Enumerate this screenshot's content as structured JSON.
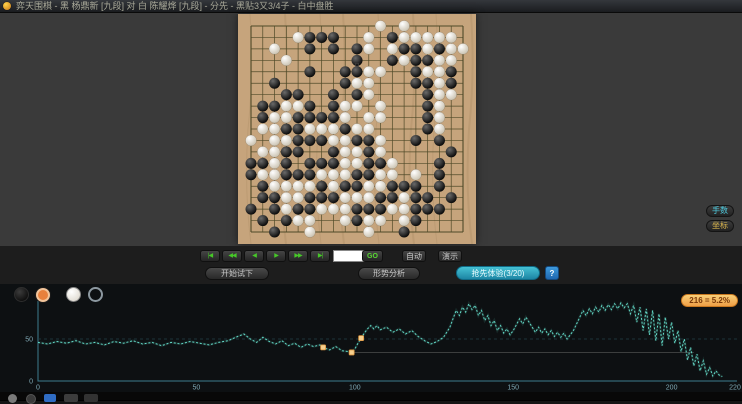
{
  "window": {
    "title": "弈天围棋 - 黑 杨鼎新 [九段] 对 白 陈耀烨 [九段] - 分先 - 黑贴3又3/4子 - 白中盘胜"
  },
  "board": {
    "size": 19,
    "wood_color": "#c6a47c",
    "line_color": "#4f4a28",
    "rows": [
      "...........W.W.....",
      "....WBBB..W.BWWWWW.",
      "..W..B.B.BW.WBBWBWW",
      "...W.....B..BWBBWW.",
      ".....B..BBWW..BWWB.",
      "..B.....BWW...BBWB.",
      "...BB..B.BW....BWW.",
      ".BBWWB.BWW.W...BW..",
      ".BWWBBBBW.WW...BW..",
      ".WWBBWWWBWW....BW..",
      "W.WWBBBWWBBW..B.B..",
      ".WWBB..BWWBW.....B.",
      "BBWB.BBBWWBBW...B..",
      "BWWBBBWWWBBWW.W.B..",
      ".BWWWWBWBBWWBBB.B..",
      ".BBWWBBBWWWBBWBB.B.",
      "B.BWBBWWWBBBWWBBB..",
      ".B.BWW..WBWW.WB....",
      "..B..W....W..B....."
    ],
    "last_move": {
      "col": 10,
      "row": 4
    }
  },
  "side_buttons": [
    {
      "label": "手数",
      "color": "#4cc8dc"
    },
    {
      "label": "坐标",
      "color": "#d8b44c"
    }
  ],
  "controls": {
    "nav": [
      "|◀",
      "◀◀",
      "◀",
      "▶",
      "▶▶",
      "▶|"
    ],
    "move_input_value": "",
    "go_label": "GO",
    "auto_label": "自动",
    "demo_label": "演示",
    "trial_label": "开始试下",
    "analysis_label": "形势分析",
    "premium_label": "抢先体验(3/20)",
    "help_label": "?"
  },
  "chart_data": {
    "type": "line",
    "title": "",
    "xlabel": "",
    "ylabel": "",
    "xlim": [
      0,
      220
    ],
    "ylim": [
      0,
      100
    ],
    "x_ticks": [
      0,
      50,
      100,
      150,
      200,
      220
    ],
    "y_ticks": [
      0,
      50
    ],
    "grid_50_percent": true,
    "axis_color": "#3d7c8e",
    "tick_label_color": "#7fa8b4",
    "legend": [
      "black-winrate-selected",
      "white-winrate"
    ],
    "series": [
      {
        "name": "win-rate",
        "color": "#62d8c6",
        "points": [
          [
            0,
            46
          ],
          [
            3,
            44
          ],
          [
            6,
            47
          ],
          [
            9,
            45
          ],
          [
            12,
            48
          ],
          [
            15,
            44
          ],
          [
            18,
            46
          ],
          [
            21,
            43
          ],
          [
            24,
            47
          ],
          [
            27,
            45
          ],
          [
            30,
            48
          ],
          [
            33,
            44
          ],
          [
            36,
            46
          ],
          [
            39,
            42
          ],
          [
            42,
            46
          ],
          [
            45,
            44
          ],
          [
            48,
            47
          ],
          [
            51,
            45
          ],
          [
            54,
            43
          ],
          [
            57,
            46
          ],
          [
            60,
            48
          ],
          [
            63,
            53
          ],
          [
            65,
            56
          ],
          [
            67,
            50
          ],
          [
            69,
            46
          ],
          [
            71,
            52
          ],
          [
            73,
            47
          ],
          [
            75,
            44
          ],
          [
            77,
            48
          ],
          [
            79,
            42
          ],
          [
            81,
            45
          ],
          [
            83,
            40
          ],
          [
            85,
            44
          ],
          [
            87,
            41
          ],
          [
            89,
            43
          ],
          [
            90,
            40
          ],
          [
            92,
            37
          ],
          [
            94,
            41
          ],
          [
            96,
            36
          ],
          [
            98,
            35
          ],
          [
            99,
            34
          ],
          [
            100,
            38
          ],
          [
            101,
            45
          ],
          [
            102,
            51
          ],
          [
            103,
            57
          ],
          [
            104,
            62
          ],
          [
            105,
            66
          ],
          [
            106,
            62
          ],
          [
            107,
            66
          ],
          [
            108,
            61
          ],
          [
            110,
            64
          ],
          [
            112,
            58
          ],
          [
            114,
            62
          ],
          [
            116,
            56
          ],
          [
            118,
            60
          ],
          [
            120,
            53
          ],
          [
            122,
            48
          ],
          [
            124,
            44
          ],
          [
            126,
            47
          ],
          [
            128,
            52
          ],
          [
            130,
            64
          ],
          [
            131,
            74
          ],
          [
            132,
            84
          ],
          [
            133,
            78
          ],
          [
            134,
            88
          ],
          [
            135,
            82
          ],
          [
            136,
            92
          ],
          [
            137,
            85
          ],
          [
            138,
            90
          ],
          [
            139,
            78
          ],
          [
            140,
            84
          ],
          [
            141,
            72
          ],
          [
            142,
            78
          ],
          [
            143,
            66
          ],
          [
            144,
            72
          ],
          [
            145,
            60
          ],
          [
            146,
            66
          ],
          [
            147,
            57
          ],
          [
            148,
            62
          ],
          [
            149,
            55
          ],
          [
            150,
            60
          ],
          [
            151,
            67
          ],
          [
            152,
            74
          ],
          [
            153,
            68
          ],
          [
            154,
            76
          ],
          [
            155,
            70
          ],
          [
            156,
            64
          ],
          [
            157,
            58
          ],
          [
            158,
            64
          ],
          [
            159,
            57
          ],
          [
            160,
            62
          ],
          [
            161,
            55
          ],
          [
            162,
            60
          ],
          [
            163,
            53
          ],
          [
            164,
            58
          ],
          [
            165,
            52
          ],
          [
            166,
            57
          ],
          [
            167,
            50
          ],
          [
            168,
            55
          ],
          [
            169,
            60
          ],
          [
            170,
            68
          ],
          [
            171,
            76
          ],
          [
            172,
            84
          ],
          [
            173,
            78
          ],
          [
            174,
            86
          ],
          [
            175,
            80
          ],
          [
            176,
            88
          ],
          [
            177,
            82
          ],
          [
            178,
            90
          ],
          [
            179,
            84
          ],
          [
            180,
            91
          ],
          [
            181,
            85
          ],
          [
            182,
            92
          ],
          [
            183,
            86
          ],
          [
            184,
            93
          ],
          [
            185,
            87
          ],
          [
            186,
            92
          ],
          [
            187,
            80
          ],
          [
            188,
            90
          ],
          [
            189,
            70
          ],
          [
            190,
            88
          ],
          [
            191,
            60
          ],
          [
            192,
            86
          ],
          [
            193,
            55
          ],
          [
            194,
            84
          ],
          [
            195,
            48
          ],
          [
            196,
            80
          ],
          [
            197,
            42
          ],
          [
            198,
            76
          ],
          [
            199,
            50
          ],
          [
            200,
            70
          ],
          [
            201,
            45
          ],
          [
            202,
            60
          ],
          [
            203,
            35
          ],
          [
            204,
            50
          ],
          [
            205,
            25
          ],
          [
            206,
            40
          ],
          [
            207,
            18
          ],
          [
            208,
            32
          ],
          [
            209,
            12
          ],
          [
            210,
            24
          ],
          [
            211,
            8
          ],
          [
            212,
            16
          ],
          [
            213,
            6
          ],
          [
            214,
            12
          ],
          [
            215,
            7
          ],
          [
            216,
            5.2
          ]
        ]
      }
    ],
    "markers": [
      [
        90,
        40
      ],
      [
        99,
        34
      ],
      [
        102,
        51
      ]
    ],
    "marker_color": "#f6d08e",
    "reference_line": {
      "x1": 99,
      "x2": 207,
      "value": 34
    },
    "tooltip": {
      "text": "216 = 5.2%"
    }
  },
  "taskbar": {
    "icons": [
      "circle-icon",
      "circle-icon",
      "start-icon",
      "window-icon",
      "window-icon"
    ]
  }
}
